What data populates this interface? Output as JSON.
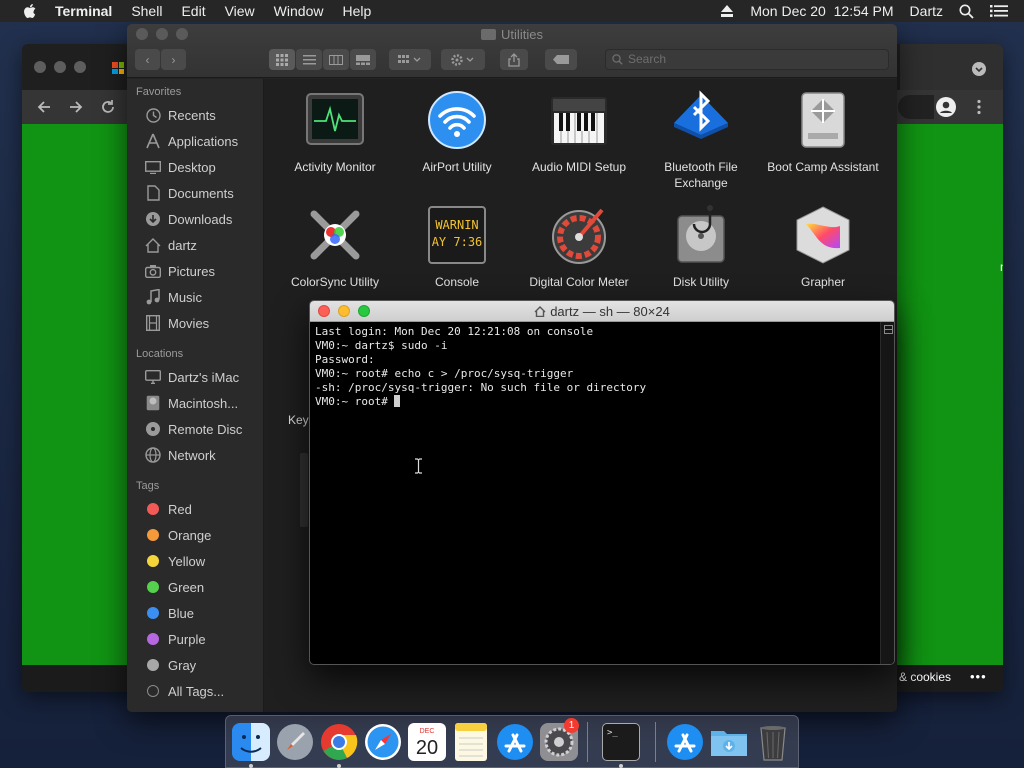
{
  "menubar": {
    "app_name": "Terminal",
    "items": [
      "Shell",
      "Edit",
      "View",
      "Window",
      "Help"
    ],
    "datetime": "Mon Dec 20  12:54 PM",
    "user": "Dartz"
  },
  "browser": {
    "footer_link": "& cookies",
    "footer_more": "•••",
    "side_text": "m"
  },
  "finder": {
    "title": "Utilities",
    "search_placeholder": "Search",
    "sidebar": {
      "favorites_label": "Favorites",
      "favorites": [
        "Recents",
        "Applications",
        "Desktop",
        "Documents",
        "Downloads",
        "dartz",
        "Pictures",
        "Music",
        "Movies"
      ],
      "locations_label": "Locations",
      "locations": [
        "Dartz's iMac",
        "Macintosh...",
        "Remote Disc",
        "Network"
      ],
      "tags_label": "Tags",
      "tags": [
        {
          "label": "Red",
          "color": "#f25a57"
        },
        {
          "label": "Orange",
          "color": "#f59a3b"
        },
        {
          "label": "Yellow",
          "color": "#f4d63c"
        },
        {
          "label": "Green",
          "color": "#55d14e"
        },
        {
          "label": "Blue",
          "color": "#3b8ff2"
        },
        {
          "label": "Purple",
          "color": "#b768e0"
        },
        {
          "label": "Gray",
          "color": "#a8a8a8"
        }
      ],
      "all_tags": "All Tags..."
    },
    "apps_row1": [
      "Activity Monitor",
      "AirPort Utility",
      "Audio MIDI Setup",
      "Bluetooth File Exchange",
      "Boot Camp Assistant"
    ],
    "apps_row2": [
      "ColorSync Utility",
      "Console",
      "Digital Color Meter",
      "Disk Utility",
      "Grapher"
    ],
    "console_icon_text": [
      "WARNIN",
      "AY 7:36"
    ],
    "partial_label": "Key"
  },
  "terminal": {
    "title": "dartz — sh — 80×24",
    "lines": [
      "Last login: Mon Dec 20 12:21:08 on console",
      "VM0:~ dartz$ sudo -i",
      "Password:",
      "VM0:~ root# echo c > /proc/sysq-trigger",
      "-sh: /proc/sysq-trigger: No such file or directory",
      "VM0:~ root# "
    ]
  },
  "dock": {
    "apps": [
      "Finder",
      "Launchpad",
      "Chrome",
      "Safari",
      "Calendar",
      "Notes",
      "App Store",
      "System Preferences",
      "Terminal",
      "Applications",
      "Downloads",
      "Trash"
    ],
    "calendar_month": "DEC",
    "calendar_day": "20",
    "badge": "1",
    "terminal_prompt": ">_"
  },
  "colors": {
    "green_page": "#119413",
    "terminal_bg": "#000000",
    "finder_bg": "#1f1f1f"
  }
}
